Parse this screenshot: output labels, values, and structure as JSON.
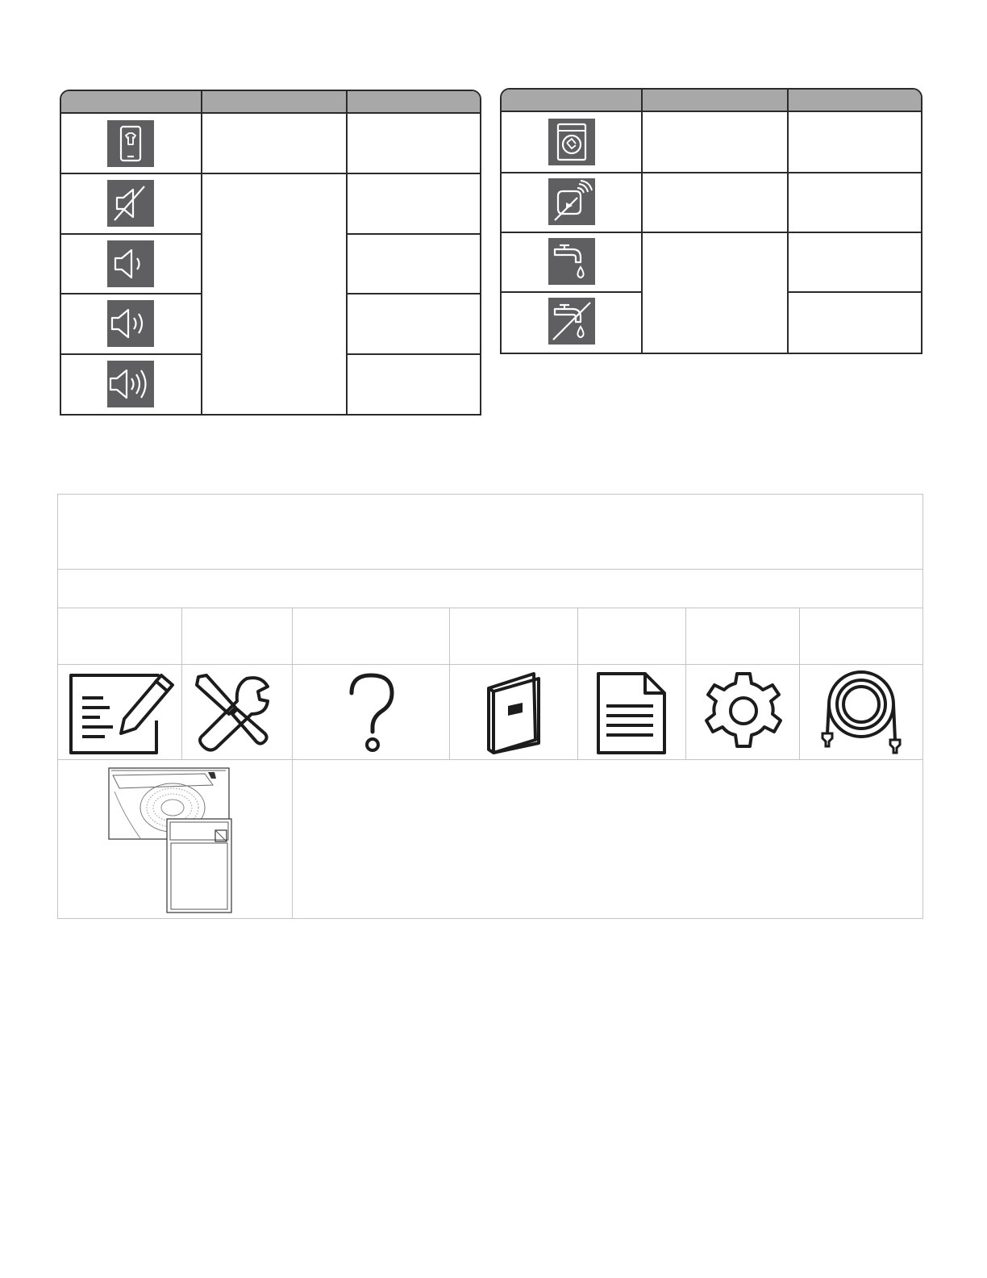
{
  "left_table": {
    "icons": [
      "shirt-phone-icon",
      "mute-icon",
      "volume-low-icon",
      "volume-medium-icon",
      "volume-high-icon"
    ]
  },
  "right_table": {
    "icons": [
      "drum-clean-icon",
      "remote-start-icon",
      "water-tap-icon",
      "water-tap-off-icon"
    ]
  },
  "reference_grid": {
    "icons": [
      "notes-icon",
      "tools-icon",
      "question-icon",
      "manual-book-icon",
      "document-icon",
      "gear-icon",
      "hose-icon"
    ],
    "illustration": "washer-top-load-illustration"
  },
  "colors": {
    "icon_tile": "#5f5f62",
    "table_header": "#a8a8a8",
    "table_border": "#2a2a2a",
    "grid_border": "#c4c4c4"
  }
}
